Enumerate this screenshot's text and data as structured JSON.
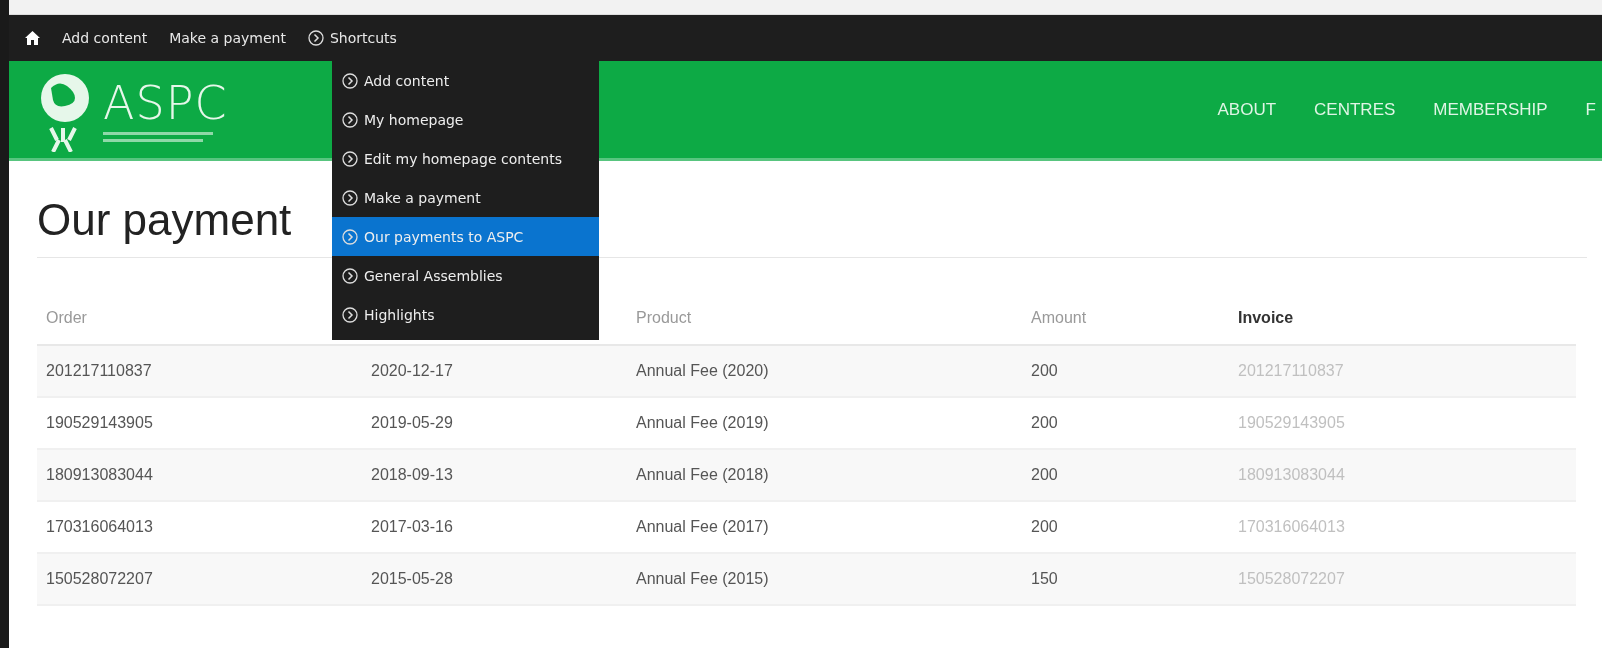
{
  "toolbar": {
    "items": [
      {
        "kind": "home"
      },
      {
        "kind": "link",
        "label": "Add content"
      },
      {
        "kind": "link",
        "label": "Make a payment"
      },
      {
        "kind": "shortcuts",
        "label": "Shortcuts"
      }
    ]
  },
  "shortcuts_menu": {
    "expanded": true,
    "items": [
      {
        "label": "Add content",
        "selected": false
      },
      {
        "label": "My homepage",
        "selected": false
      },
      {
        "label": "Edit my homepage contents",
        "selected": false
      },
      {
        "label": "Make a payment",
        "selected": false
      },
      {
        "label": "Our payments to ASPC",
        "selected": true
      },
      {
        "label": "General Assemblies",
        "selected": false
      },
      {
        "label": "Highlights",
        "selected": false
      }
    ]
  },
  "header": {
    "logo": "ASPC",
    "nav": [
      "ABOUT",
      "CENTRES",
      "MEMBERSHIP",
      "F"
    ]
  },
  "page_title": "Our payment",
  "table": {
    "columns": [
      {
        "label": "Order",
        "kind": "plain"
      },
      {
        "kind": "hidden"
      },
      {
        "label": "Product",
        "kind": "plain"
      },
      {
        "label": "Amount",
        "kind": "plain"
      },
      {
        "label": "Invoice",
        "kind": "link"
      }
    ],
    "rows": [
      [
        "201217110837",
        "2020-12-17",
        "Annual Fee (2020)",
        "200",
        "201217110837"
      ],
      [
        "190529143905",
        "2019-05-29",
        "Annual Fee (2019)",
        "200",
        "190529143905"
      ],
      [
        "180913083044",
        "2018-09-13",
        "Annual Fee (2018)",
        "200",
        "180913083044"
      ],
      [
        "170316064013",
        "2017-03-16",
        "Annual Fee (2017)",
        "200",
        "170316064013"
      ],
      [
        "150528072207",
        "2015-05-28",
        "Annual Fee (2015)",
        "150",
        "150528072207"
      ]
    ]
  }
}
